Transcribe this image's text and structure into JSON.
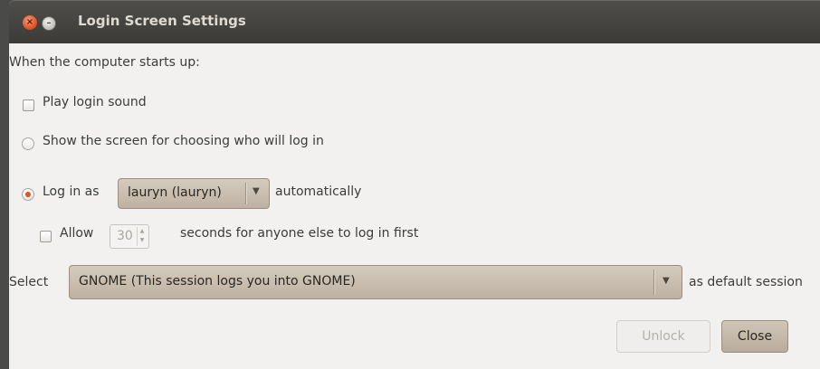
{
  "window": {
    "title": "Login Screen Settings",
    "controls": {
      "close": "×",
      "minimize": "–"
    }
  },
  "intro_label": "When the computer starts up:",
  "options": {
    "play_login_sound": {
      "label": "Play login sound",
      "checked": false
    },
    "show_screen": {
      "label": "Show the screen for choosing who will log in",
      "selected": false
    },
    "log_in_as": {
      "label": "Log in as",
      "selected": true,
      "user": "lauryn (lauryn)",
      "suffix": "automatically"
    },
    "allow": {
      "label": "Allow",
      "checked": false,
      "seconds": "30",
      "suffix": "seconds for anyone else to log in first"
    }
  },
  "session": {
    "label": "Select",
    "value": "GNOME (This session logs you into GNOME)",
    "suffix": "as default session"
  },
  "buttons": {
    "unlock": "Unlock",
    "close": "Close"
  },
  "icons": {
    "dropdown_arrow": "▼",
    "spin_up": "▲",
    "spin_down": "▼"
  },
  "colors": {
    "accent": "#e0551c",
    "titlebar": "#3c3b37",
    "background": "#f2f1f0"
  }
}
